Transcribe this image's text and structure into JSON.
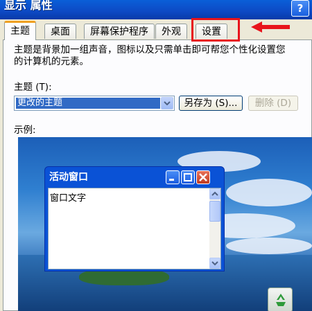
{
  "window": {
    "title": "显示 属性",
    "help_button": "?"
  },
  "tabs": [
    {
      "label": "主题",
      "active": true
    },
    {
      "label": "桌面"
    },
    {
      "label": "屏幕保护程序"
    },
    {
      "label": "外观"
    },
    {
      "label": "设置",
      "highlighted": true
    }
  ],
  "theme_page": {
    "description": "主题是背景加一组声音，图标以及只需单击即可帮您个性化设置您的计算机的元素。",
    "theme_label": "主题 (T):",
    "theme_selected": "更改的主题",
    "save_as_button": "另存为 (S)...",
    "delete_button": "删除 (D)",
    "example_label": "示例:"
  },
  "preview_window": {
    "title": "活动窗口",
    "text": "窗口文字"
  },
  "colors": {
    "annotation": "#e8141c",
    "titlebar": "#0a5fd8",
    "selection": "#316ac5"
  },
  "icons": [
    "help-icon",
    "dropdown-arrow-icon",
    "minimize-icon",
    "maximize-icon",
    "close-icon",
    "scroll-up-icon",
    "scroll-down-icon",
    "recycle-bin-icon",
    "arrow-left-icon"
  ]
}
